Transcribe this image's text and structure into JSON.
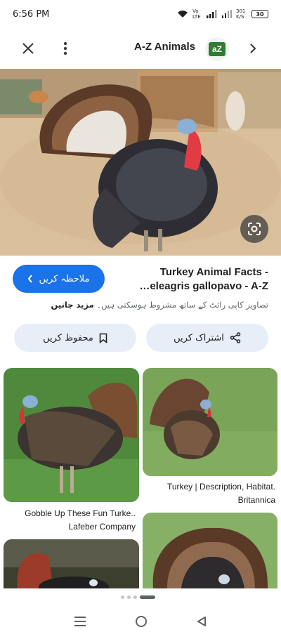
{
  "status_bar": {
    "time": "6:56 PM",
    "net_label": "Vo LTE",
    "speed_label": "301 K/S",
    "battery": "30"
  },
  "top_bar": {
    "source_title": "A-Z Animals",
    "logo_text": "aZ"
  },
  "result": {
    "visit_label": "ملاحظہ کریں",
    "title_line1": "Turkey Animal Facts -",
    "title_line2": "…eleagris gallopavo - A-Z",
    "copyright_text": "تصاویر کاپی رائٹ کے ساتھ مشروط ہوسکتی ہیں۔",
    "copyright_more": "مزید جانیں"
  },
  "actions": {
    "save_label": "محفوظ کریں",
    "share_label": "اشتراک کریں"
  },
  "related": [
    {
      "caption": "Gobble Up These Fun Turke..",
      "source": "Lafeber Company"
    },
    {
      "caption": "Turkey | Description, Habitat.",
      "source": "Britannica"
    }
  ],
  "colors": {
    "accent": "#1a73e8",
    "chip_bg": "#e8eef8"
  },
  "icons": [
    "close-icon",
    "more-vert-icon",
    "chevron-right-icon",
    "lens-icon",
    "bookmark-icon",
    "share-icon",
    "recents-icon",
    "home-icon",
    "back-icon"
  ]
}
